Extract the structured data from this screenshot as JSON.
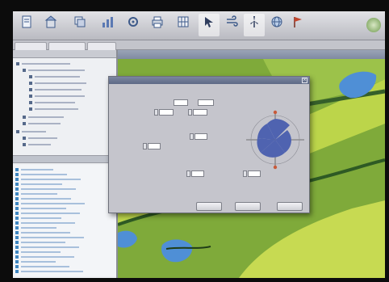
{
  "toolbar": {
    "buttons": [
      {
        "icon": "document-icon",
        "label": ""
      },
      {
        "icon": "building-icon",
        "label": ""
      },
      {
        "icon": "layers-icon",
        "label": ""
      },
      {
        "icon": "chart-icon",
        "label": ""
      },
      {
        "icon": "tool-icon",
        "label": ""
      },
      {
        "icon": "print-icon",
        "label": ""
      },
      {
        "icon": "grid-icon",
        "label": ""
      },
      {
        "icon": "arrow-icon",
        "label": ""
      },
      {
        "icon": "wind-icon",
        "label": ""
      },
      {
        "icon": "windmill-icon",
        "label": ""
      },
      {
        "icon": "globe-icon",
        "label": ""
      },
      {
        "icon": "flag-icon",
        "label": ""
      }
    ]
  },
  "tabs": [
    {
      "label": ""
    },
    {
      "label": ""
    },
    {
      "label": ""
    }
  ],
  "window_title": "",
  "left_panel": {
    "header": "",
    "layer_header": ""
  },
  "dialog": {
    "title": "",
    "group_top": "",
    "group_mid": "",
    "group_bottom": "",
    "field_labels": [
      "",
      "",
      "",
      "",
      "",
      "",
      ""
    ],
    "field_values": [
      "",
      "",
      "",
      "",
      "",
      "",
      ""
    ],
    "compass_title": "",
    "buttons": [
      {
        "label": ""
      },
      {
        "label": ""
      },
      {
        "label": ""
      }
    ]
  },
  "colors": {
    "map_green": "#7faa3a",
    "light_green": "#bcd54a",
    "water": "#4f8fd6",
    "wind_rose": "#4f63b0",
    "frame": "#0c0c0c"
  }
}
